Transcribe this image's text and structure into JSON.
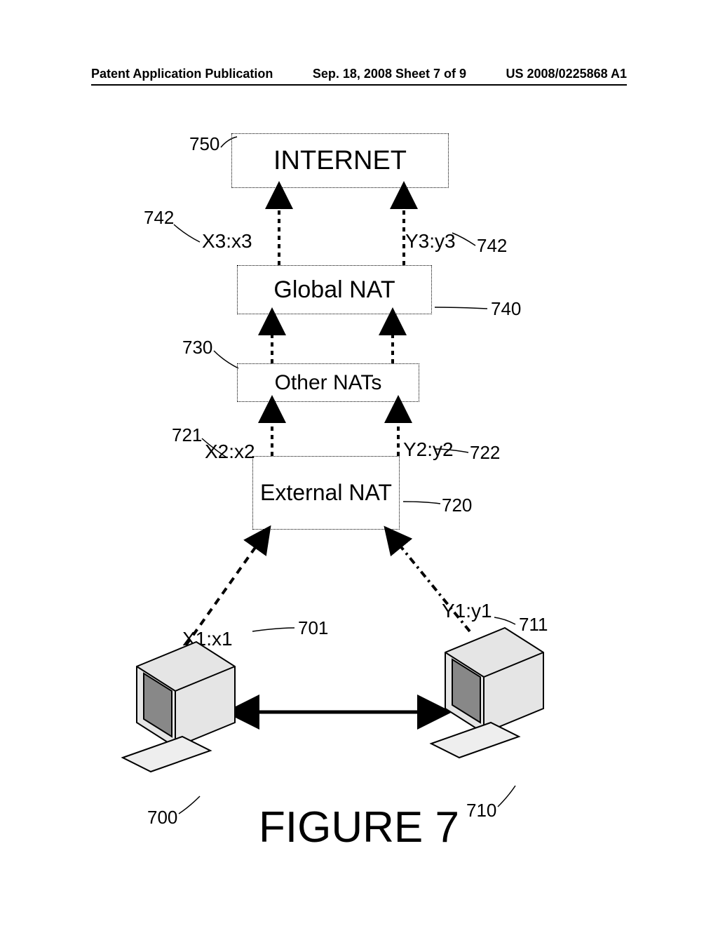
{
  "header": {
    "left": "Patent Application Publication",
    "center": "Sep. 18, 2008  Sheet 7 of 9",
    "right": "US 2008/0225868 A1"
  },
  "boxes": {
    "internet": "INTERNET",
    "global_nat": "Global NAT",
    "other_nats": "Other NATs",
    "external_nat": "External NAT"
  },
  "labels": {
    "x3": "X3:x3",
    "y3": "Y3:y3",
    "x2": "X2:x2",
    "y2": "Y2:y2",
    "x1": "X1:x1",
    "y1": "Y1:y1"
  },
  "refs": {
    "r750": "750",
    "r742a": "742",
    "r742b": "742",
    "r740": "740",
    "r730": "730",
    "r721": "721",
    "r722": "722",
    "r720": "720",
    "r701": "701",
    "r711": "711",
    "r700": "700",
    "r710": "710"
  },
  "figure": "FIGURE 7"
}
